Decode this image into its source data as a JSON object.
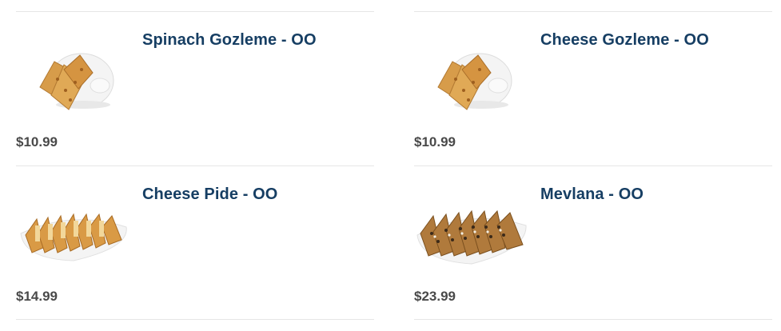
{
  "menu": {
    "items": [
      {
        "name": "Spinach Gozleme - OO",
        "price": "$10.99",
        "image": "gozleme-plate-image"
      },
      {
        "name": "Cheese Gozleme - OO",
        "price": "$10.99",
        "image": "gozleme-plate-image"
      },
      {
        "name": "Cheese Pide - OO",
        "price": "$14.99",
        "image": "pide-plate-image"
      },
      {
        "name": "Mevlana - OO",
        "price": "$23.99",
        "image": "mevlana-plate-image"
      }
    ]
  },
  "colors": {
    "title": "#163e63",
    "price": "#494949",
    "divider": "#e6e6e6"
  }
}
